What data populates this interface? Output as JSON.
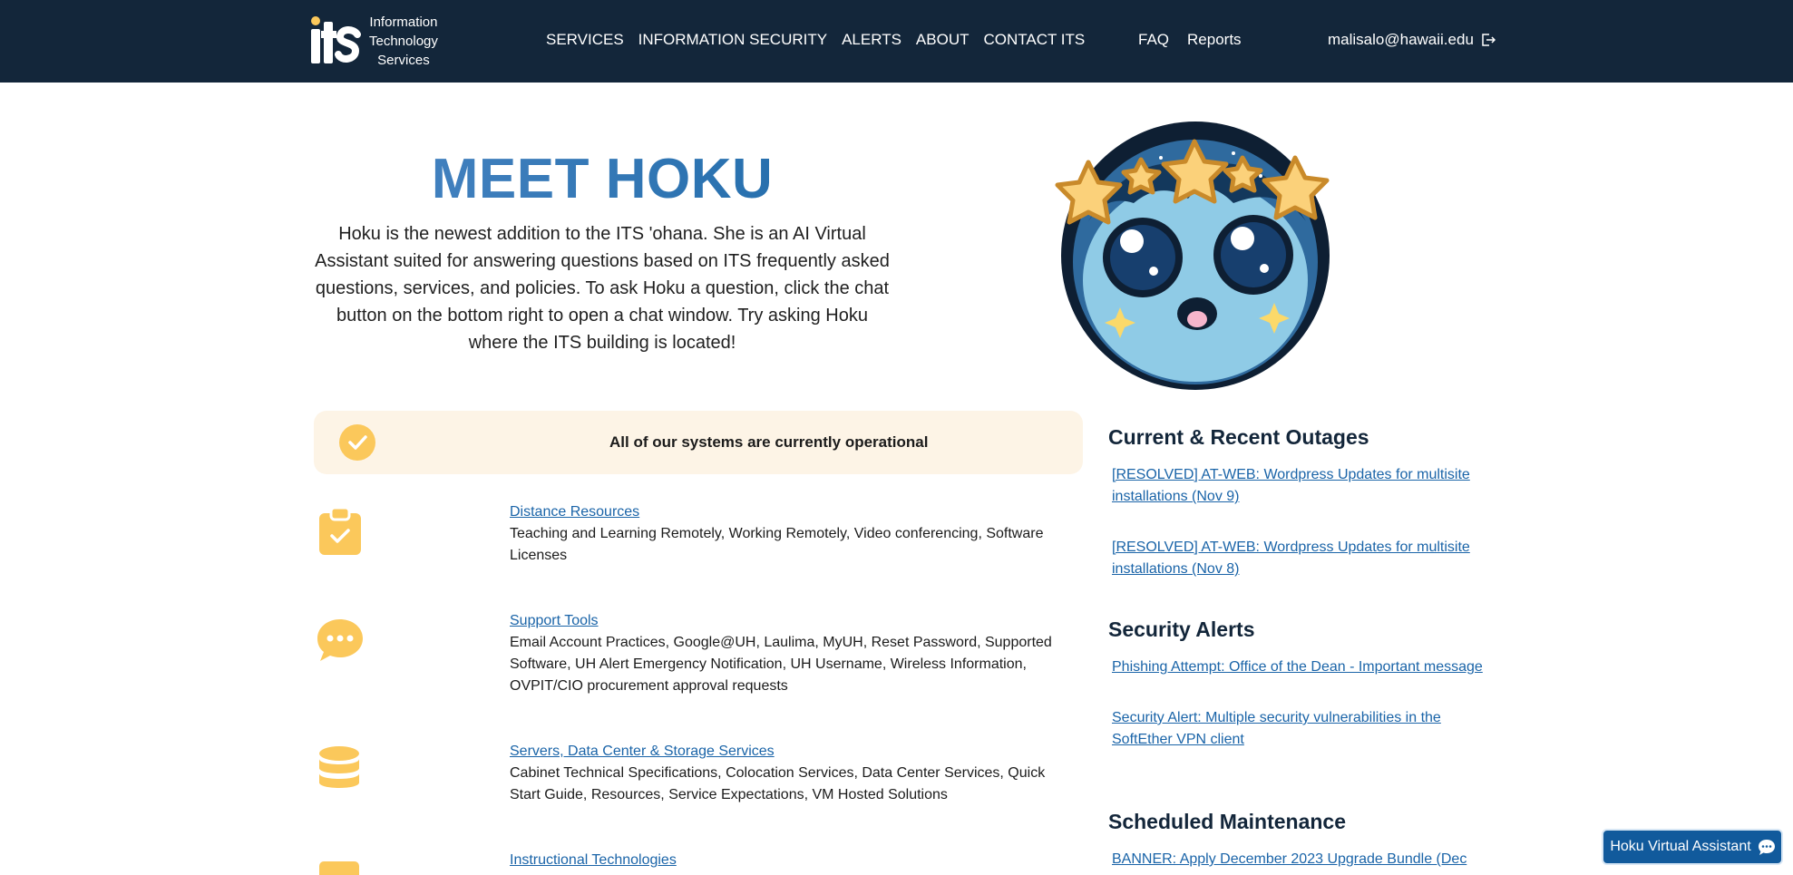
{
  "header": {
    "logo_text": "its",
    "logo_caption": [
      "Information",
      "Technology",
      "Services"
    ],
    "nav_main": [
      "SERVICES",
      "INFORMATION SECURITY",
      "ALERTS",
      "ABOUT",
      "CONTACT ITS"
    ],
    "nav_secondary": [
      "FAQ",
      "Reports"
    ],
    "user_email": "malisalo@hawaii.edu",
    "logout_icon": "logout-icon"
  },
  "hero": {
    "title": "MEET HOKU",
    "description": "Hoku is the newest addition to the ITS 'ohana. She is an AI Virtual Assistant suited for answering questions based on ITS frequently asked questions, services, and policies. To ask Hoku a question, click the chat button on the bottom right to open a chat window. Try asking Hoku where the ITS building is located!"
  },
  "status": {
    "message": "All of our systems are currently operational",
    "icon": "check-circle-icon"
  },
  "services": [
    {
      "title": "Distance Resources",
      "description": "Teaching and Learning Remotely, Working Remotely, Video conferencing, Software Licenses",
      "icon": "clipboard-check-icon"
    },
    {
      "title": "Support Tools",
      "description": "Email Account Practices, Google@UH, Laulima, MyUH, Reset Password, Supported Software, UH Alert Emergency Notification, UH Username, Wireless Information, OVPIT/CIO procurement approval requests",
      "icon": "chat-bubble-icon"
    },
    {
      "title": "Servers, Data Center & Storage Services",
      "description": "Cabinet Technical Specifications, Colocation Services, Data Center Services, Quick Start Guide, Resources, Service Expectations, VM Hosted Solutions",
      "icon": "database-icon"
    },
    {
      "title": "Instructional Technologies",
      "description": "",
      "icon": "instruction-icon"
    }
  ],
  "sidebar": {
    "outages_title": "Current & Recent Outages",
    "outages": [
      "[RESOLVED] AT-WEB: Wordpress Updates for multisite installations (Nov 9)",
      "[RESOLVED] AT-WEB: Wordpress Updates for multisite installations (Nov 8)"
    ],
    "security_title": "Security Alerts",
    "security": [
      "Phishing Attempt: Office of the Dean - Important message",
      "Security Alert: Multiple security vulnerabilities in the SoftEther VPN client"
    ],
    "maintenance_title": "Scheduled Maintenance",
    "maintenance": [
      "BANNER: Apply December 2023 Upgrade Bundle (Dec"
    ]
  },
  "chat": {
    "label": "Hoku Virtual Assistant",
    "icon": "chat-icon"
  },
  "colors": {
    "header_bg": "#13263a",
    "accent_yellow": "#fbc85b",
    "link_blue": "#1a64a8",
    "status_bg": "#fdf4e6"
  }
}
